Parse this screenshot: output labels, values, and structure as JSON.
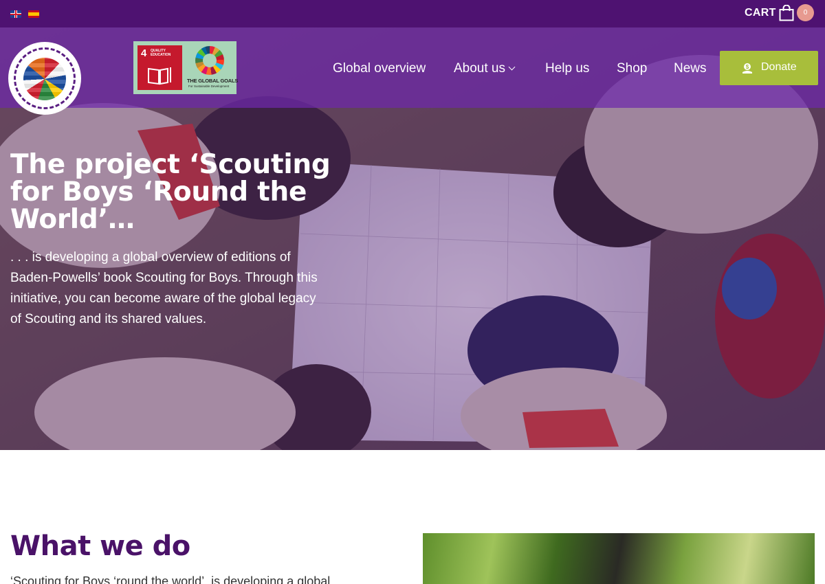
{
  "topbar": {
    "languages": [
      {
        "name": "uk-flag-icon",
        "lang": "English"
      },
      {
        "name": "spain-flag-icon",
        "lang": "Español"
      }
    ],
    "cart_label": "CART",
    "cart_count": "0"
  },
  "header": {
    "sdg_badge": {
      "number": "4",
      "small": "QUALITY\nEDUCATION",
      "title": "THE GLOBAL GOALS",
      "subtitle": "For Sustainable Development"
    },
    "nav": [
      {
        "label": "Global overview"
      },
      {
        "label": "About us"
      },
      {
        "label": "Help us"
      },
      {
        "label": "Shop"
      },
      {
        "label": "News"
      }
    ],
    "donate_label": "Donate"
  },
  "hero": {
    "title": "The project ‘Scouting for Boys ‘Round the World’…",
    "text": ". . . is developing a global overview of editions of Baden-Powells’ book Scouting for Boys. Through this initiative, you can become aware of the global legacy of Scouting and its shared values."
  },
  "what_we_do": {
    "title": "What we do",
    "text": "‘Scouting for Boys ‘round the world’, is developing a global"
  },
  "colors": {
    "topbar": "#4e1271",
    "nav_overlay": "#6e28aa",
    "donate": "#a8be3b",
    "heading": "#4a1268",
    "cart_badge": "#e79a90"
  }
}
